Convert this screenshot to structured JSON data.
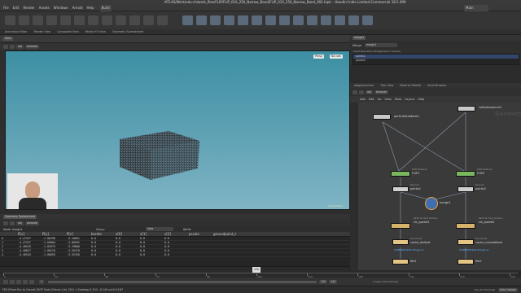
{
  "window": {
    "title": "/ATLAS/Work/edu-ch/work_files/FLIP/FLIP_010_250_Narrow_Band/FLIP_010_250_Narrow_Band_002.hiplc - Houdini Indie Limited-Commercial 18.5.499"
  },
  "menu": [
    "File",
    "Edit",
    "Render",
    "Assets",
    "Windows",
    "Arnold",
    "Help"
  ],
  "desktop": "Build",
  "search_placeholder": "Main",
  "shelf_tabs": [
    "Animation Editor",
    "Render View",
    "Composite View",
    "Motion FX View",
    "Geometry Spreadsheet"
  ],
  "viewport": {
    "tab_label": "View",
    "path": [
      "obj",
      "torbaste"
    ],
    "persp_label": "Persp",
    "cam_label": "No cam",
    "corner_label": "Indie Edition"
  },
  "spreadsheet": {
    "tab_label": "Geometry Spreadsheet",
    "path": [
      "obj",
      "torbaste"
    ],
    "node_label": "Node: merge1",
    "group_label": "Group:",
    "view_label": "View",
    "attrib_label": "Attrib:",
    "columns": [
      "",
      "P[x]",
      "P[y]",
      "P[z]",
      "border",
      "v[0]",
      "v[1]",
      "v[2]",
      "pscale",
      "groundpoint_t"
    ],
    "rows": [
      [
        "0",
        "-4.47327",
        "-1.06298",
        "-3.10691",
        "0.0",
        "0.0",
        "0.0",
        "0.0",
        "",
        ""
      ],
      [
        "1",
        "-4.47327",
        "-1.05804",
        "-3.08202",
        "0.0",
        "0.0",
        "0.0",
        "0.0",
        "",
        ""
      ],
      [
        "2",
        "-4.46543",
        "-1.05979",
        "-3.29866",
        "0.0",
        "0.0",
        "0.0",
        "0.0",
        "",
        ""
      ],
      [
        "3",
        "-4.46827",
        "-1.06118",
        "-3.26470",
        "0.0",
        "0.0",
        "0.0",
        "0.0",
        "",
        ""
      ],
      [
        "4",
        "-4.46543",
        "-1.06695",
        "-3.52430",
        "0.0",
        "0.0",
        "0.0",
        "0.0",
        "",
        ""
      ]
    ]
  },
  "timeline": {
    "ticks": [
      "1",
      "24",
      "48",
      "72",
      "96",
      "120",
      "144",
      "168",
      "192",
      "216",
      "240"
    ],
    "current_frame": "120",
    "start": "1",
    "end": "240",
    "end2": "240",
    "keys_label": "0 keys, 0/0 channels",
    "keys_label2": "Key All Channels",
    "auto_update": "Auto Update"
  },
  "status": "FE0 (Press Esc to Cancel) DOP Cook (Frame 4 to 120) + Substep 0.120 : 0.140 until 0.167",
  "params": {
    "tab_label": "merge1",
    "node_type": "Merge",
    "node_name": "merge1",
    "label": "Input Operators (Drag/Drop to reorder)",
    "inputs": [
      "points1",
      "points2"
    ]
  },
  "network": {
    "tabs": [
      "objgeo/surface",
      "Tree View",
      "Material Palette",
      "Asset Browser"
    ],
    "path": [
      "obj",
      "torbaste"
    ],
    "menu": [
      "Add",
      "Edit",
      "Go",
      "View",
      "Tools",
      "Layout",
      "Help"
    ],
    "watermark": "Geometry",
    "nodes": [
      {
        "name": "particlefluidtank2",
        "sub": ""
      },
      {
        "name": "collisionsource2",
        "sub": ""
      },
      {
        "name": "FLIP1",
        "sub": "DOP Network"
      },
      {
        "name": "FLIP2",
        "sub": "DOP Network"
      },
      {
        "name": "points1",
        "sub": "Dop I/O"
      },
      {
        "name": "points2",
        "sub": "Dop I/O"
      },
      {
        "name": "merge1",
        "sub": ""
      },
      {
        "name": "vis_speed1",
        "sub": "Particle Fluid Surface"
      },
      {
        "name": "vis_speed2",
        "sub": "Particle Fluid Surface"
      },
      {
        "name": "cache_default",
        "sub": "File Cache",
        "stat": "$HIPNAME.$OS.$F.bgeo.sc"
      },
      {
        "name": "cache_narrowBand",
        "sub": "File Cache",
        "stat": "$HIPNAME.$OS.$F.bgeo.sc"
      },
      {
        "name": "file1",
        "sub": ""
      },
      {
        "name": "file2",
        "sub": ""
      }
    ]
  },
  "colors": {
    "accent": "#e8a33d",
    "node_green": "#7bb661",
    "node_yellow": "#d6b36a"
  }
}
